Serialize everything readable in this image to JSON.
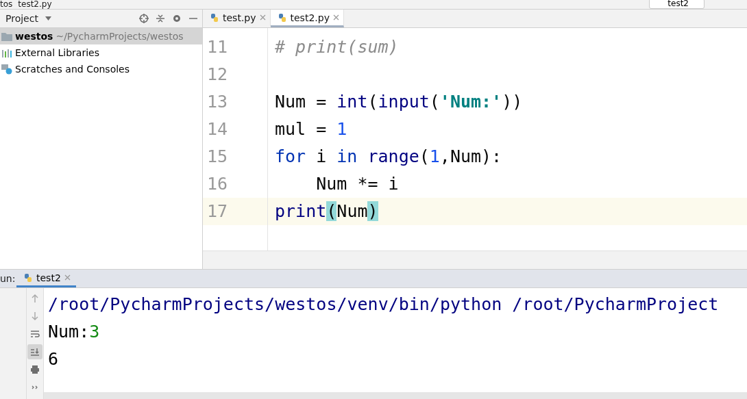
{
  "breadcrumb": [
    "tos",
    "test2.py"
  ],
  "run_config": "test2",
  "project_panel": {
    "title": "Project",
    "tree": [
      {
        "name": "westos",
        "path": "~/PycharmProjects/westos",
        "kind": "folder",
        "selected": true
      },
      {
        "name": "External Libraries",
        "kind": "libraries",
        "selected": false
      },
      {
        "name": "Scratches and Consoles",
        "kind": "scratches",
        "selected": false
      }
    ]
  },
  "editor_tabs": [
    {
      "label": "test.py",
      "selected": false
    },
    {
      "label": "test2.py",
      "selected": true
    }
  ],
  "editor": {
    "lines": [
      {
        "number": "11",
        "current": false,
        "tokens": [
          {
            "text": "# print(sum)",
            "kind": "comment"
          }
        ]
      },
      {
        "number": "12",
        "current": false
      },
      {
        "number": "13",
        "current": false,
        "tokens": [
          {
            "text": "Num = ",
            "kind": "plain"
          },
          {
            "text": "int",
            "kind": "builtin"
          },
          {
            "text": "(",
            "kind": "plain"
          },
          {
            "text": "input",
            "kind": "builtin"
          },
          {
            "text": "(",
            "kind": "plain"
          },
          {
            "text": "'Num:'",
            "kind": "string"
          },
          {
            "text": "))",
            "kind": "plain"
          }
        ]
      },
      {
        "number": "14",
        "current": false,
        "tokens": [
          {
            "text": "mul = ",
            "kind": "plain"
          },
          {
            "text": "1",
            "kind": "number"
          }
        ]
      },
      {
        "number": "15",
        "current": false,
        "tokens": [
          {
            "text": "for",
            "kind": "keyword"
          },
          {
            "text": " i ",
            "kind": "plain"
          },
          {
            "text": "in",
            "kind": "keyword"
          },
          {
            "text": " range",
            "kind": "builtin"
          },
          {
            "text": "(",
            "kind": "plain"
          },
          {
            "text": "1",
            "kind": "number"
          },
          {
            "text": ",Num):",
            "kind": "plain"
          }
        ]
      },
      {
        "number": "16",
        "current": false,
        "tokens": [
          {
            "text": "    Num *= i",
            "kind": "plain"
          }
        ]
      },
      {
        "number": "17",
        "current": true,
        "tokens": [
          {
            "text": "print",
            "kind": "builtin"
          },
          {
            "text": "(",
            "kind": "match"
          },
          {
            "text": "Num",
            "kind": "plain"
          },
          {
            "text": ")",
            "kind": "match"
          }
        ]
      }
    ]
  },
  "run_panel": {
    "label": "un:",
    "tab": {
      "label": "test2",
      "selected": true
    },
    "tools": [
      {
        "kind": "up",
        "selected": false
      },
      {
        "kind": "down",
        "selected": false
      },
      {
        "kind": "wrap",
        "selected": false
      },
      {
        "kind": "scroll-end",
        "selected": true
      },
      {
        "kind": "print",
        "selected": false
      },
      {
        "kind": "more",
        "selected": false
      }
    ],
    "console": [
      [
        {
          "text": "/root/PycharmProjects/westos/venv/bin/python /root/PycharmProject",
          "kind": "system"
        }
      ],
      [
        {
          "text": "Num:",
          "kind": "output"
        },
        {
          "text": "3",
          "kind": "input"
        }
      ],
      [
        {
          "text": "6",
          "kind": "output"
        }
      ]
    ]
  }
}
